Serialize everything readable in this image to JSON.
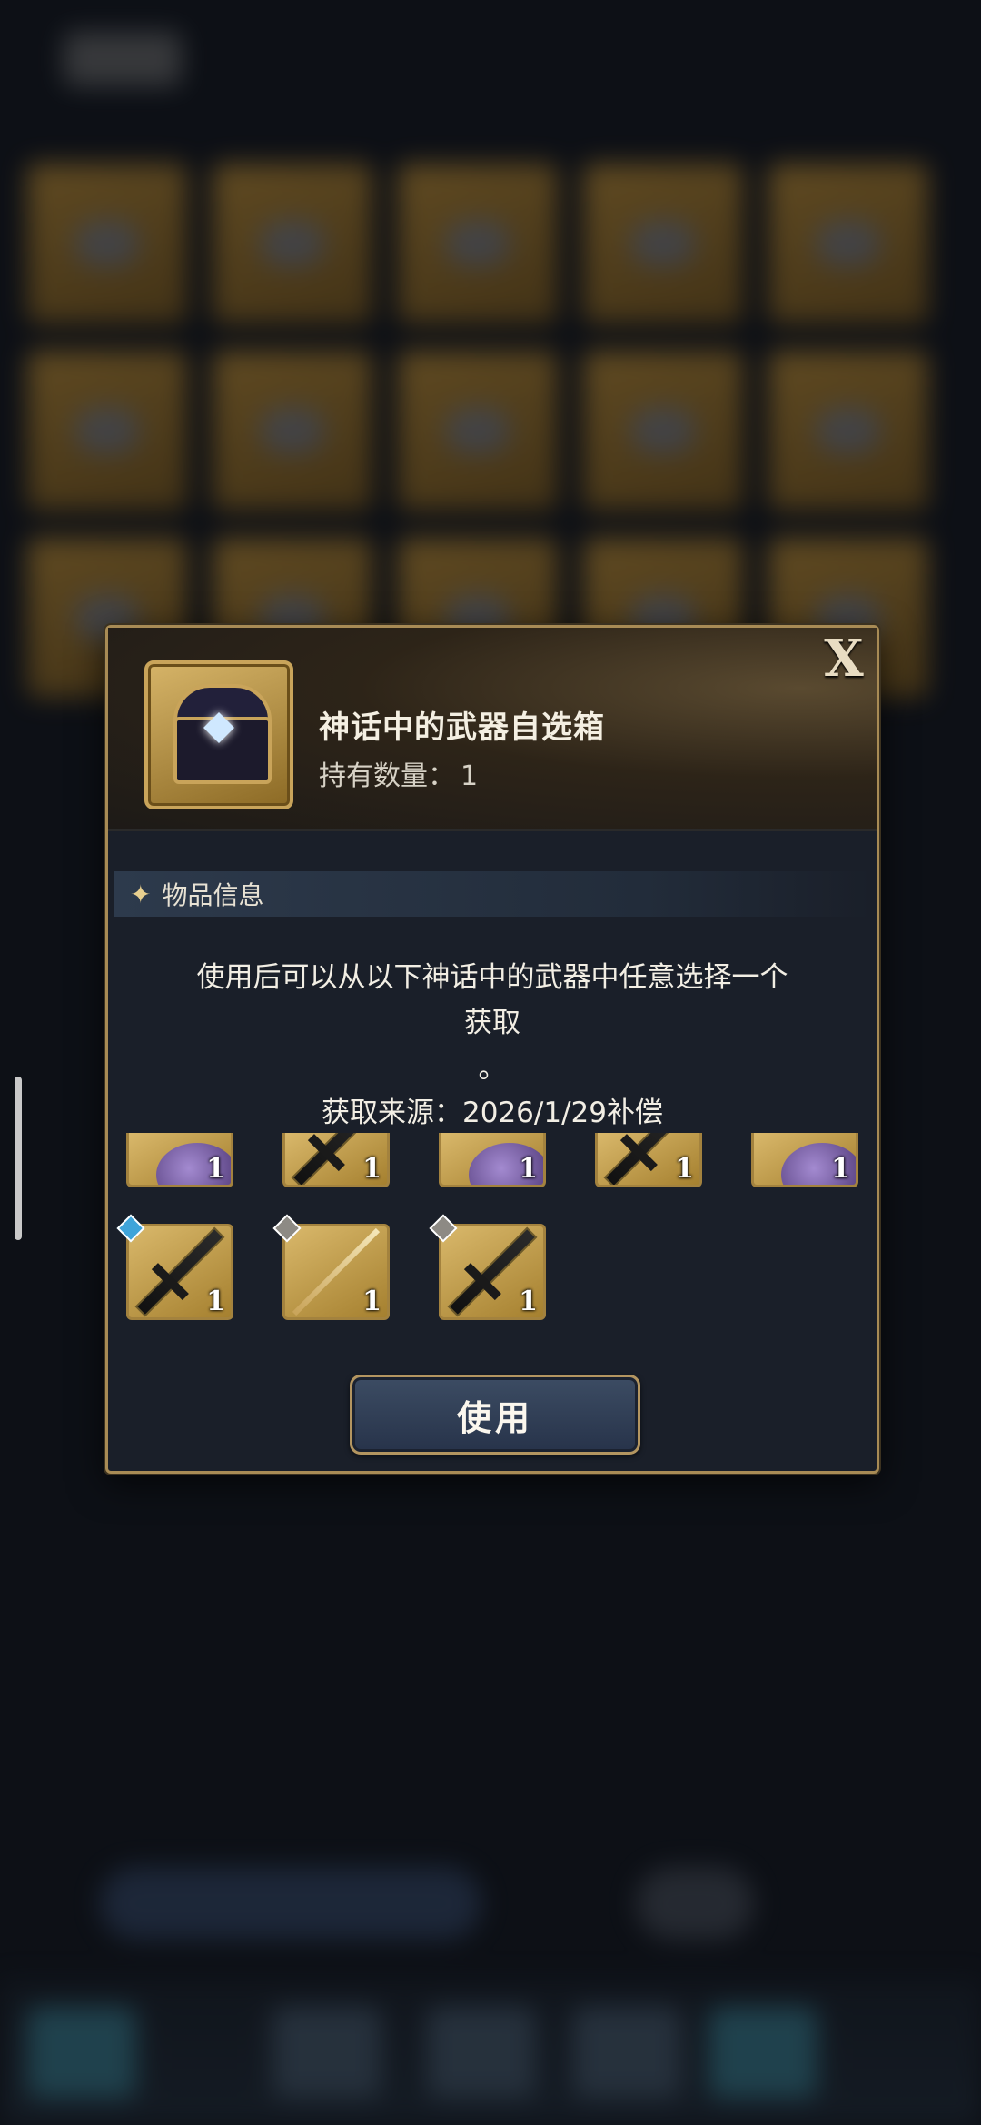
{
  "dialog": {
    "item_name": "神话中的武器自选箱",
    "count_label": "持有数量：",
    "count_value": "1",
    "close_label": "X",
    "section_title": "物品信息",
    "description_line1": "使用后可以从以下神话中的武器中任意选择一个",
    "description_line2": "获取",
    "description_line3": "。",
    "source_text": "获取来源：2026/1/29补偿",
    "use_button_label": "使用"
  },
  "rewards": [
    {
      "art": "orb",
      "qty": "1",
      "badge": null
    },
    {
      "art": "sword",
      "qty": "1",
      "badge": null
    },
    {
      "art": "orb",
      "qty": "1",
      "badge": null
    },
    {
      "art": "sword",
      "qty": "1",
      "badge": null
    },
    {
      "art": "orb",
      "qty": "1",
      "badge": null
    },
    {
      "art": "sword",
      "qty": "1",
      "badge": "blue"
    },
    {
      "art": "spear",
      "qty": "1",
      "badge": "gray"
    },
    {
      "art": "sword",
      "qty": "1",
      "badge": "gray"
    }
  ],
  "colors": {
    "frame_gold": "#a88b55",
    "dialog_bg": "#1a1f29",
    "badge_blue": "#3fa4d9"
  }
}
